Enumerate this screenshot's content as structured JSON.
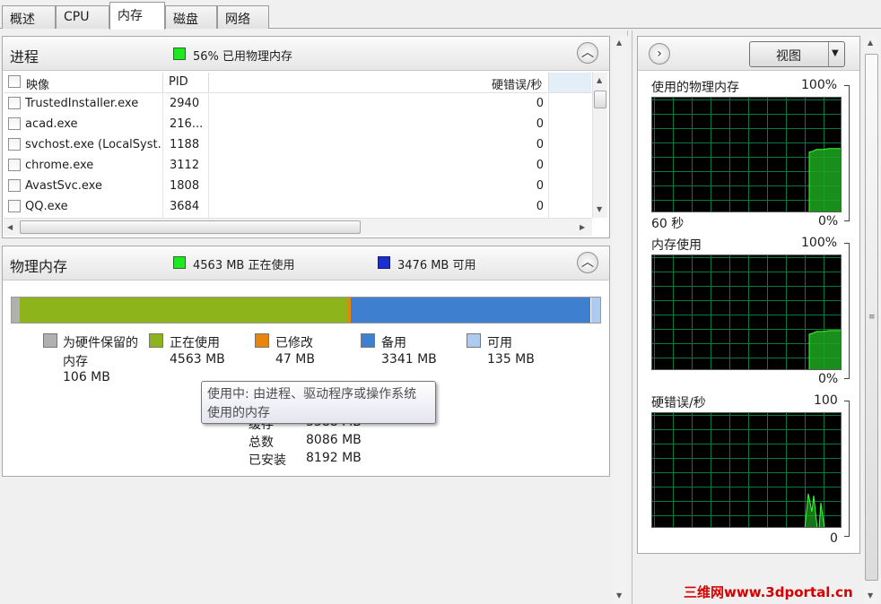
{
  "tabs": [
    {
      "label": "概述"
    },
    {
      "label": "CPU"
    },
    {
      "label": "内存"
    },
    {
      "label": "磁盘"
    },
    {
      "label": "网络"
    }
  ],
  "process_panel": {
    "title": "进程",
    "summary": "56% 已用物理内存",
    "indicator_color": "#1ee81e",
    "columns": {
      "image": "映像",
      "pid": "PID",
      "hard_faults": "硬错误/秒"
    },
    "rows": [
      {
        "image": "TrustedInstaller.exe",
        "pid": "2940",
        "hard_faults": "0"
      },
      {
        "image": "acad.exe",
        "pid": "216...",
        "hard_faults": "0"
      },
      {
        "image": "svchost.exe (LocalSyst...",
        "pid": "1188",
        "hard_faults": "0"
      },
      {
        "image": "chrome.exe",
        "pid": "3112",
        "hard_faults": "0"
      },
      {
        "image": "AvastSvc.exe",
        "pid": "1808",
        "hard_faults": "0"
      },
      {
        "image": "QQ.exe",
        "pid": "3684",
        "hard_faults": "0"
      }
    ]
  },
  "memory_panel": {
    "title": "物理内存",
    "in_use_summary": "4563 MB 正在使用",
    "available_summary": "3476 MB 可用",
    "bar": {
      "hardware_reserved_fraction": 0.013,
      "in_use_fraction": 0.557,
      "modified_fraction": 0.006,
      "standby_fraction": 0.408,
      "free_fraction": 0.016
    },
    "legend": [
      {
        "label": "为硬件保留的",
        "label2": "内存",
        "value": "106 MB",
        "color": "#b0b0b0"
      },
      {
        "label": "正在使用",
        "value": "4563 MB",
        "color": "#8db51b"
      },
      {
        "label": "已修改",
        "value": "47 MB",
        "color": "#e8860c"
      },
      {
        "label": "备用",
        "value": "3341 MB",
        "color": "#3f7fd0"
      },
      {
        "label": "可用",
        "value": "135 MB",
        "color": "#aecaee"
      }
    ],
    "stats": [
      {
        "label": "缓存",
        "value": "3388 MB"
      },
      {
        "label": "总数",
        "value": "8086 MB"
      },
      {
        "label": "已安装",
        "value": "8192 MB"
      }
    ],
    "tooltip_line1": "使用中: 由进程、驱动程序或操作系统",
    "tooltip_line2": "使用的内存"
  },
  "graphs_panel": {
    "view_button": "视图",
    "graphs": [
      {
        "title": "使用的物理内存",
        "max": "100%",
        "min": "0%",
        "time_label": "60 秒",
        "recent_level_pct": 56
      },
      {
        "title": "内存使用",
        "max": "100%",
        "min": "0%",
        "recent_level_pct": 35
      },
      {
        "title": "硬错误/秒",
        "max": "100",
        "min": "0"
      }
    ]
  },
  "watermark": "三维网www.3dportal.cn"
}
